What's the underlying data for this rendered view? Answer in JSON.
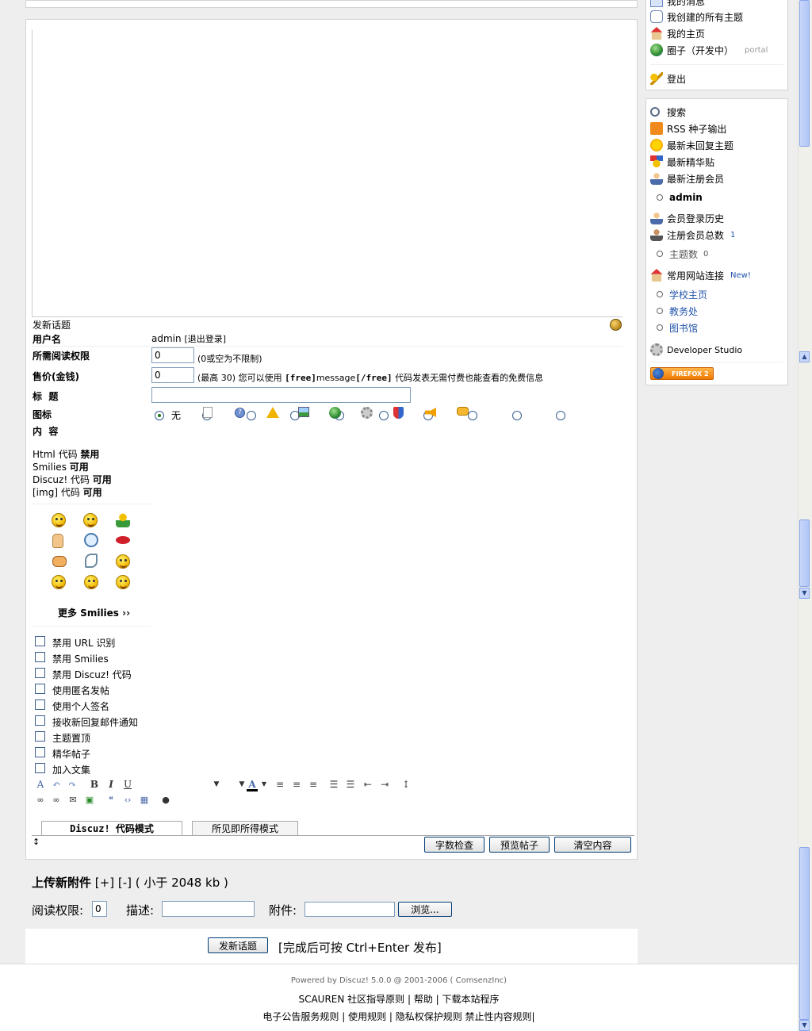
{
  "sidebar_top": {
    "items": [
      {
        "label": "我的消息",
        "icon": "message-icon"
      },
      {
        "label": "我创建的所有主题",
        "icon": "comments-icon"
      },
      {
        "label": "我的主页",
        "icon": "home-icon"
      },
      {
        "label": "圈子（开发中）",
        "icon": "globe-icon",
        "suffix": "portal"
      },
      {
        "label": "登出",
        "icon": "logout-key-icon"
      }
    ]
  },
  "sidebar_bottom": {
    "search": "搜索",
    "rss": "RSS 种子输出",
    "latest_unreplied": "最新未回复主题",
    "latest_digest": "最新精华贴",
    "latest_members": "最新注册会员",
    "latest_member_name": "admin",
    "login_history": "会员登录历史",
    "member_count_label": "注册会员总数",
    "member_count": "1",
    "topic_count_label": "主题数",
    "topic_count": "0",
    "links_label": "常用网站连接",
    "links_badge": "New!",
    "links": [
      "学校主页",
      "教务处",
      "图书馆"
    ],
    "developer_studio": "Developer Studio",
    "firefox_badge": "FIREFOX 2"
  },
  "form": {
    "section_title": "发新话题",
    "username_label": "用户名",
    "username_value": "admin",
    "logout_link": "[退出登录]",
    "read_perm_label": "所需阅读权限",
    "read_perm_value": "0",
    "read_perm_hint": "(0或空为不限制)",
    "price_label": "售价(金钱)",
    "price_value": "0",
    "price_hint_prefix": "(最高 30) 您可以使用",
    "price_free_open": "[free]",
    "price_message": "message",
    "price_free_close": "[/free]",
    "price_hint_suffix": "代码发表无需付费也能查看的免费信息",
    "title_label": "标  题",
    "icon_label": "图标",
    "icon_none": "无",
    "content_label": "内  容",
    "html_code": {
      "label": "Html 代码",
      "state": "禁用"
    },
    "smilies": {
      "label": "Smilies",
      "state": "可用"
    },
    "discuz_code": {
      "label": "Discuz! 代码",
      "state": "可用"
    },
    "img_code": {
      "label": "[img] 代码",
      "state": "可用"
    },
    "more_smilies": "更多 Smilies ››",
    "options": [
      "禁用 URL 识别",
      "禁用 Smilies",
      "禁用 Discuz! 代码",
      "使用匿名发帖",
      "使用个人签名",
      "接收新回复邮件通知",
      "主题置顶",
      "精华帖子",
      "加入文集"
    ],
    "mode_tabs": [
      "Discuz! 代码模式",
      "所见即所得模式"
    ],
    "resize_glyph": "↕",
    "buttons": {
      "word_count": "字数检查",
      "preview": "预览帖子",
      "clear": "清空内容"
    }
  },
  "upload": {
    "title": "上传新附件",
    "controls": "[+] [-] ( 小于 2048 kb )",
    "perm_label": "阅读权限:",
    "perm_value": "0",
    "desc_label": "描述:",
    "file_label": "附件:",
    "browse": "浏览..."
  },
  "submit": {
    "button": "发新话题",
    "hint": "[完成后可按 Ctrl+Enter 发布]"
  },
  "footer": {
    "powered": "Powered by Discuz! 5.0.0 @ 2001-2006 ( ComsenzInc)",
    "links_row1": "SCAUREN 社区指导原则 | 帮助 | 下载本站程序",
    "links_row2": "电子公告服务规则 | 使用规则 | 隐私权保护规则 禁止性内容规则|"
  }
}
